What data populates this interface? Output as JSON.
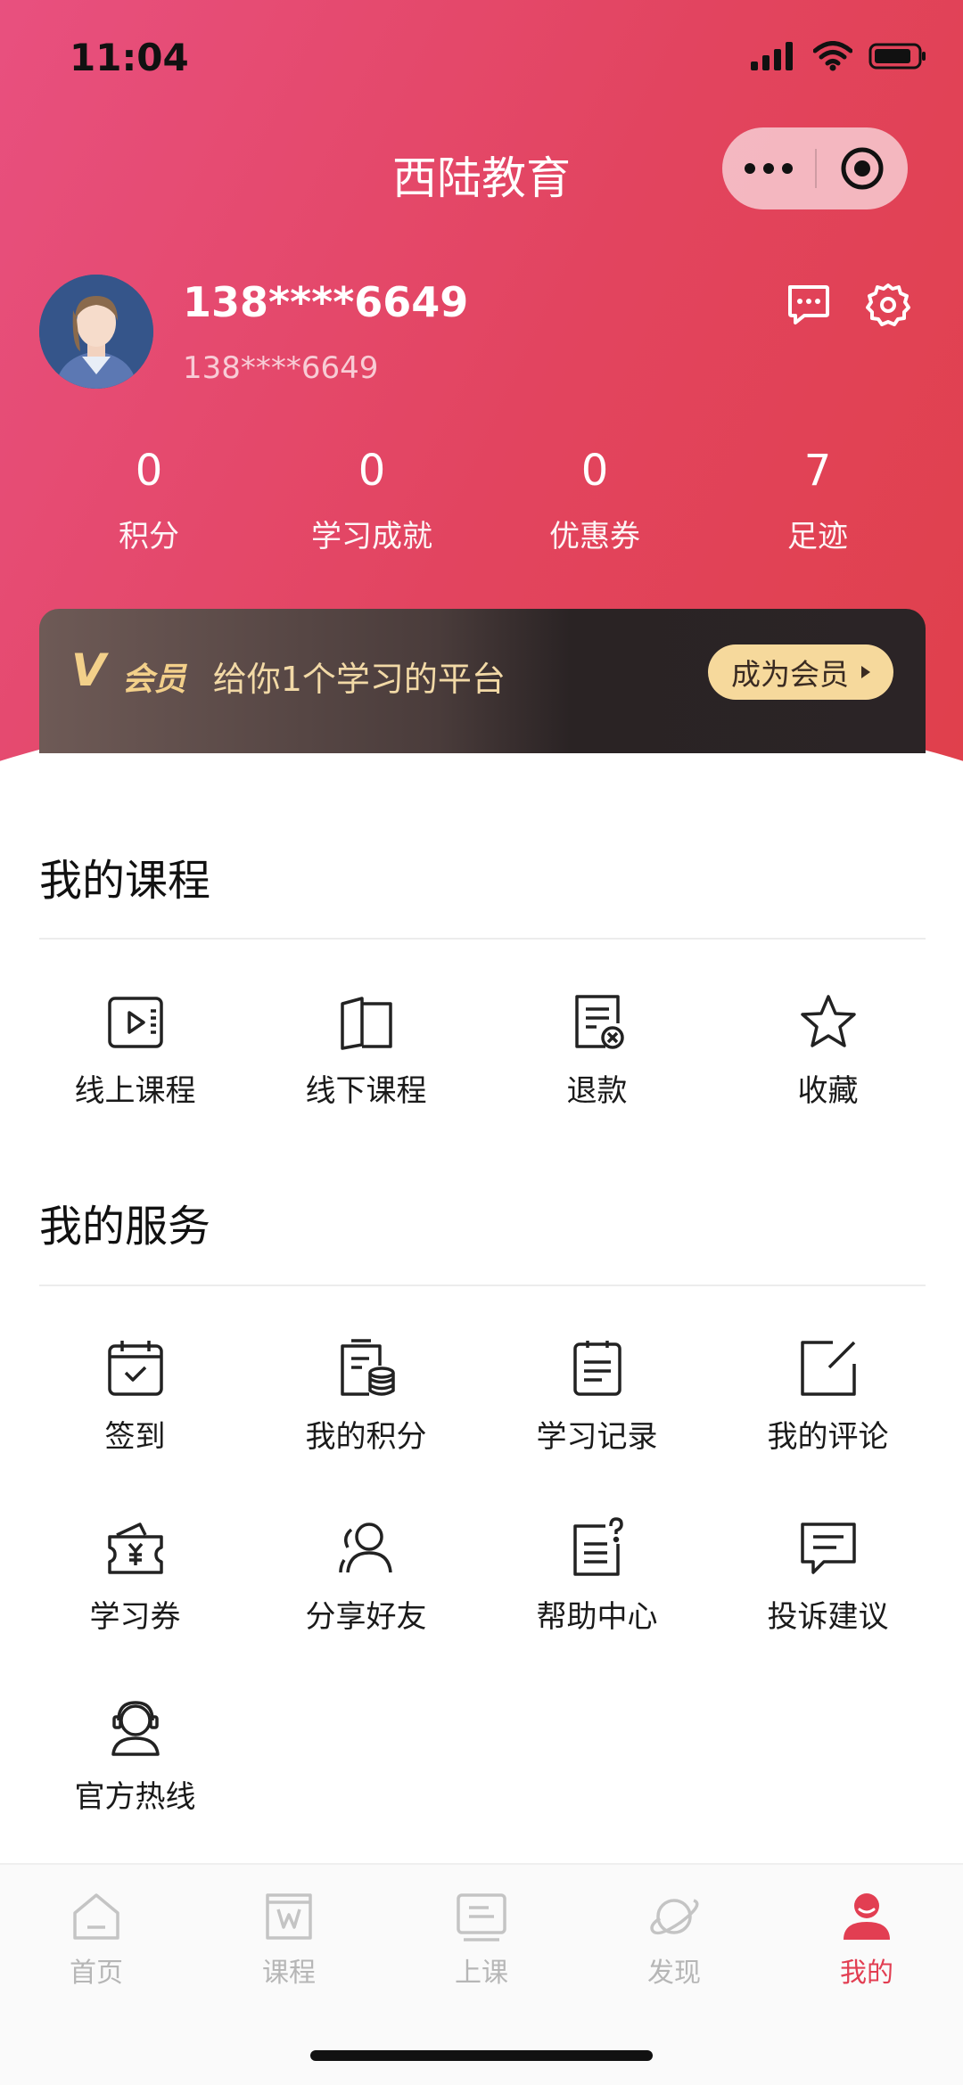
{
  "status_bar": {
    "time": "11:04"
  },
  "nav": {
    "title": "西陆教育"
  },
  "profile": {
    "name": "138****6649",
    "phone": "138****6649"
  },
  "stats": [
    {
      "value": "0",
      "label": "积分"
    },
    {
      "value": "0",
      "label": "学习成就"
    },
    {
      "value": "0",
      "label": "优惠券"
    },
    {
      "value": "7",
      "label": "足迹"
    }
  ],
  "vip_banner": {
    "badge": "V",
    "label": "会员",
    "slogan": "给你1个学习的平台",
    "button": "成为会员"
  },
  "courses": {
    "title": "我的课程",
    "items": [
      {
        "label": "线上课程",
        "icon": "video-play-icon"
      },
      {
        "label": "线下课程",
        "icon": "book-icon"
      },
      {
        "label": "退款",
        "icon": "refund-doc-icon"
      },
      {
        "label": "收藏",
        "icon": "star-icon"
      }
    ]
  },
  "services": {
    "title": "我的服务",
    "items": [
      {
        "label": "签到",
        "icon": "calendar-check-icon"
      },
      {
        "label": "我的积分",
        "icon": "points-coins-icon"
      },
      {
        "label": "学习记录",
        "icon": "clipboard-icon"
      },
      {
        "label": "我的评论",
        "icon": "edit-comment-icon"
      },
      {
        "label": "学习券",
        "icon": "voucher-icon"
      },
      {
        "label": "分享好友",
        "icon": "share-friends-icon"
      },
      {
        "label": "帮助中心",
        "icon": "help-doc-icon"
      },
      {
        "label": "投诉建议",
        "icon": "feedback-icon"
      },
      {
        "label": "官方热线",
        "icon": "hotline-headset-icon"
      }
    ]
  },
  "tabbar": {
    "items": [
      {
        "label": "首页",
        "icon": "home-icon"
      },
      {
        "label": "课程",
        "icon": "course-icon"
      },
      {
        "label": "上课",
        "icon": "class-icon"
      },
      {
        "label": "发现",
        "icon": "planet-icon"
      },
      {
        "label": "我的",
        "icon": "profile-icon"
      }
    ],
    "active_index": 4
  },
  "colors": {
    "brand": "#e2445f",
    "vip_gold": "#f6d99c",
    "active_tab": "#e23e52"
  }
}
